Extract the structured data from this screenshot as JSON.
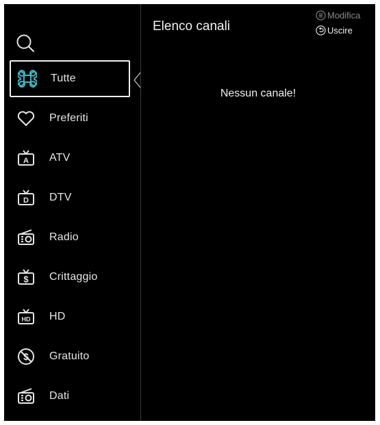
{
  "header": {
    "title": "Elenco canali"
  },
  "hints": [
    {
      "label": "Modifica",
      "icon": "menu-circle-icon",
      "enabled": false
    },
    {
      "label": "Uscire",
      "icon": "back-circle-icon",
      "enabled": true
    }
  ],
  "sidebar": {
    "search_icon": "search-icon",
    "items": [
      {
        "label": "Tutte",
        "icon": "all-channels-icon",
        "selected": true
      },
      {
        "label": "Preferiti",
        "icon": "heart-icon"
      },
      {
        "label": "ATV",
        "icon": "tv-a-icon"
      },
      {
        "label": "DTV",
        "icon": "tv-d-icon"
      },
      {
        "label": "Radio",
        "icon": "radio-icon"
      },
      {
        "label": "Crittaggio",
        "icon": "tv-dollar-icon"
      },
      {
        "label": "HD",
        "icon": "tv-hd-icon"
      },
      {
        "label": "Gratuito",
        "icon": "no-dollar-icon"
      },
      {
        "label": "Dati",
        "icon": "data-icon"
      }
    ]
  },
  "main": {
    "empty_message": "Nessun canale!"
  },
  "colors": {
    "background": "#000000",
    "text": "#f2f2f2",
    "accent": "#3fb8c4",
    "disabled": "#8a8a8a"
  }
}
